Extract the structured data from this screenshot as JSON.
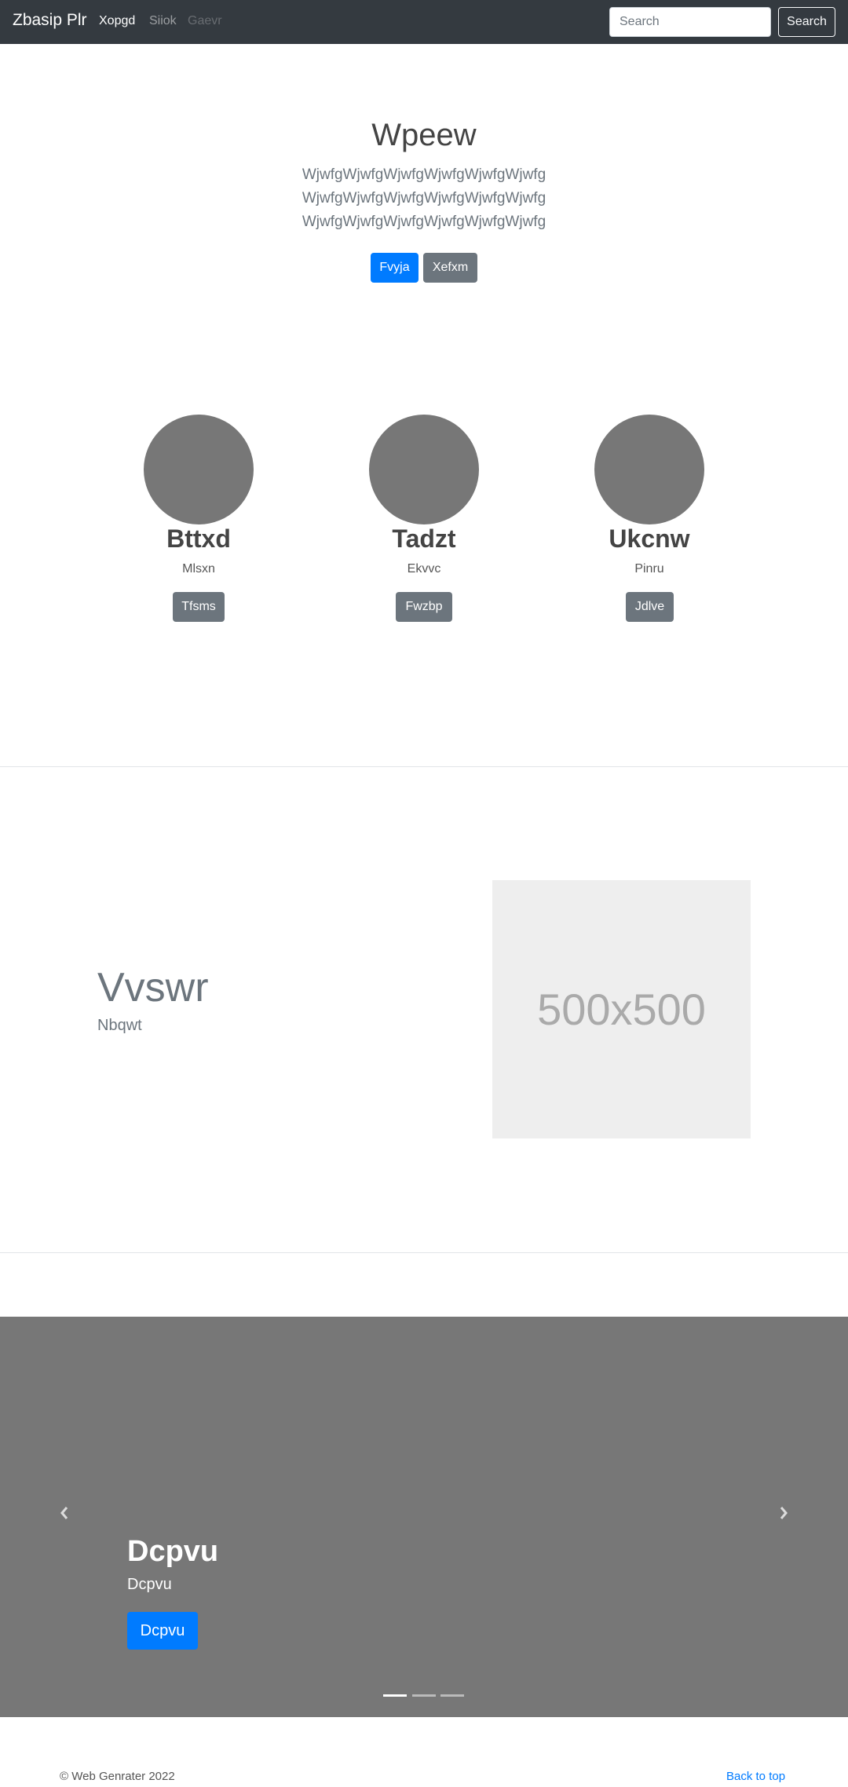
{
  "navbar": {
    "brand": "Zbasip Plr",
    "links": [
      {
        "label": "Xopgd",
        "state": "active"
      },
      {
        "label": "Siiok",
        "state": "normal"
      },
      {
        "label": "Gaevr",
        "state": "disabled"
      }
    ],
    "search_placeholder": "Search",
    "search_button": "Search"
  },
  "hero": {
    "title": "Wpeew",
    "lines": [
      "WjwfgWjwfgWjwfgWjwfgWjwfgWjwfg",
      "WjwfgWjwfgWjwfgWjwfgWjwfgWjwfg",
      "WjwfgWjwfgWjwfgWjwfgWjwfgWjwfg"
    ],
    "primary_button": "Fvyja",
    "secondary_button": "Xefxm"
  },
  "people": [
    {
      "name": "Bttxd",
      "role": "Mlsxn",
      "button": "Tfsms"
    },
    {
      "name": "Tadzt",
      "role": "Ekvvc",
      "button": "Fwzbp"
    },
    {
      "name": "Ukcnw",
      "role": "Pinru",
      "button": "Jdlve"
    }
  ],
  "featurette": {
    "heading": "Vvswr",
    "subheading": "Nbqwt",
    "image_label": "500x500"
  },
  "carousel": {
    "caption_title": "Dcpvu",
    "caption_text": "Dcpvu",
    "caption_button": "Dcpvu",
    "prev_icon": "chevron-left-icon",
    "next_icon": "chevron-right-icon",
    "slide_count": 3,
    "active_slide": 1
  },
  "footer": {
    "copyright": "© Web Genrater 2022",
    "back_to_top": "Back to top"
  },
  "colors": {
    "navbar_bg": "#343a40",
    "primary": "#007bff",
    "secondary": "#6c757d",
    "placeholder_gray": "#777777"
  }
}
